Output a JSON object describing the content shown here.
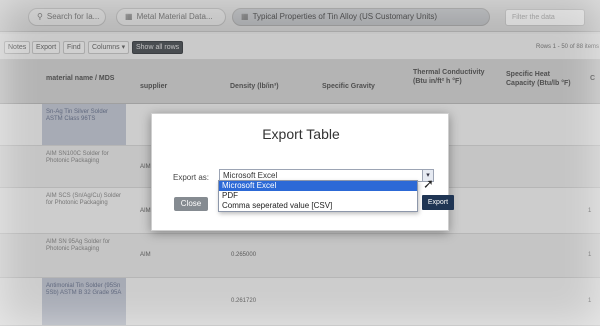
{
  "tabs": [
    {
      "label": "Search for Ia...",
      "icon": "search-icon"
    },
    {
      "label": "Metal Material Data...",
      "icon": "database-icon"
    },
    {
      "label": "Typical Properties of Tin Alloy (US Customary Units)",
      "icon": "table-icon"
    }
  ],
  "filter_placeholder": "Filter the data",
  "toolbar": {
    "items": [
      "Notes",
      "Export",
      "Find",
      "Columns ▾"
    ],
    "show_all_label": "Show all rows",
    "rows_info": "Rows 1 - 50 of 88 items"
  },
  "table": {
    "headers": {
      "name": "material name / MDS",
      "supplier": "supplier",
      "density": "Density (lb/in³)",
      "gravity": "Specific Gravity",
      "thermal": "Thermal Conductivity (Btu in/ft² h °F)",
      "heat": "Specific Heat Capacity (Btu/lb °F)",
      "edge": "C"
    },
    "rows": [
      {
        "name": "Sn-Ag Tin Silver Solder ASTM Class 96TS",
        "supplier": "",
        "density": "",
        "edge": ""
      },
      {
        "name": "AIM SN100C Solder for Photonic Packaging",
        "supplier": "AIM",
        "density": "",
        "edge": ""
      },
      {
        "name": "AIM SCS (Sn/Ag/Cu) Solder for Photonic Packaging",
        "supplier": "AIM",
        "density": "",
        "edge": "1"
      },
      {
        "name": "AIM SN 95Ag Solder for Photonic Packaging",
        "supplier": "AIM",
        "density": "0.265000",
        "edge": "1"
      },
      {
        "name": "Antimonial Tin Solder (95Sn 5Sb) ASTM B 32 Grade 95A",
        "supplier": "",
        "density": "0.261720",
        "edge": "1"
      }
    ]
  },
  "dialog": {
    "title": "Export Table",
    "export_as_label": "Export as:",
    "selected_value": "Microsoft Excel",
    "options": [
      "Microsoft Excel",
      "PDF",
      "Comma seperated value [CSV]"
    ],
    "close_label": "Close",
    "export_label": "Export"
  },
  "colors": {
    "accent": "#2c69d6",
    "export_button": "#1f3554",
    "highlight_cell": "#c6cbd8"
  }
}
